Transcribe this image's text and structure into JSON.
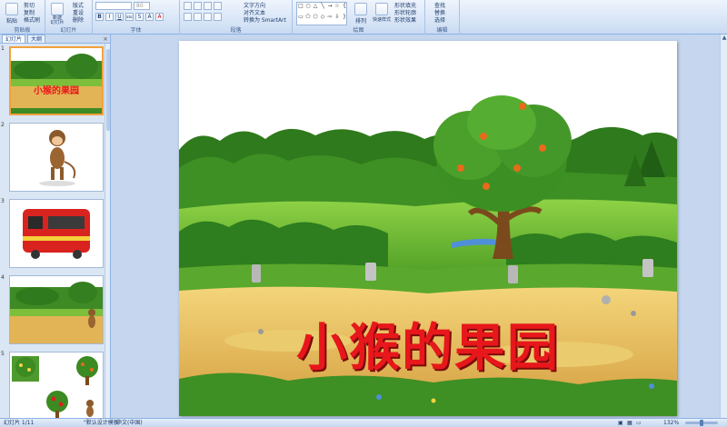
{
  "ribbon": {
    "groups": {
      "clipboard": "剪贴板",
      "slides": "幻灯片",
      "font": "字体",
      "paragraph": "段落",
      "drawing": "绘图",
      "editing": "编辑"
    },
    "clipboard": {
      "paste": "粘贴",
      "cut": "剪切",
      "copy": "复制",
      "format_painter": "格式刷"
    },
    "slides": {
      "new_slide": "新建\n幻灯片",
      "layout": "版式",
      "reset": "重设",
      "delete": "删除"
    },
    "font": {
      "size": "80",
      "bold": "B",
      "italic": "I",
      "underline": "U",
      "shadow": "S",
      "strike": "abc",
      "grow": "A",
      "color": "A"
    },
    "paragraph": {
      "text_direction": "文字方向",
      "align_text": "对齐文本",
      "smartart": "转换为 SmartArt"
    },
    "drawing": {
      "arrange": "排列",
      "quick_styles": "快速样式",
      "fill": "形状填充",
      "outline": "形状轮廓",
      "effects": "形状效果"
    },
    "editing": {
      "find": "查找",
      "replace": "替换",
      "select": "选择"
    }
  },
  "left_pane": {
    "tabs": [
      "幻灯片",
      "大纲"
    ],
    "close": "×",
    "slides": [
      {
        "num": "1",
        "title": "小猴的果园"
      },
      {
        "num": "2"
      },
      {
        "num": "3"
      },
      {
        "num": "4"
      },
      {
        "num": "5"
      }
    ]
  },
  "slide": {
    "title": "小猴的果园"
  },
  "status_bar": {
    "slide_info": "幻灯片 1/11",
    "theme": "\"默认设计模板\"",
    "language": "中文(中国)",
    "zoom": "132%"
  },
  "colors": {
    "title_red": "#e8171b",
    "selected_border": "#f2a13c",
    "ribbon_bg": "#d5e3f6"
  }
}
